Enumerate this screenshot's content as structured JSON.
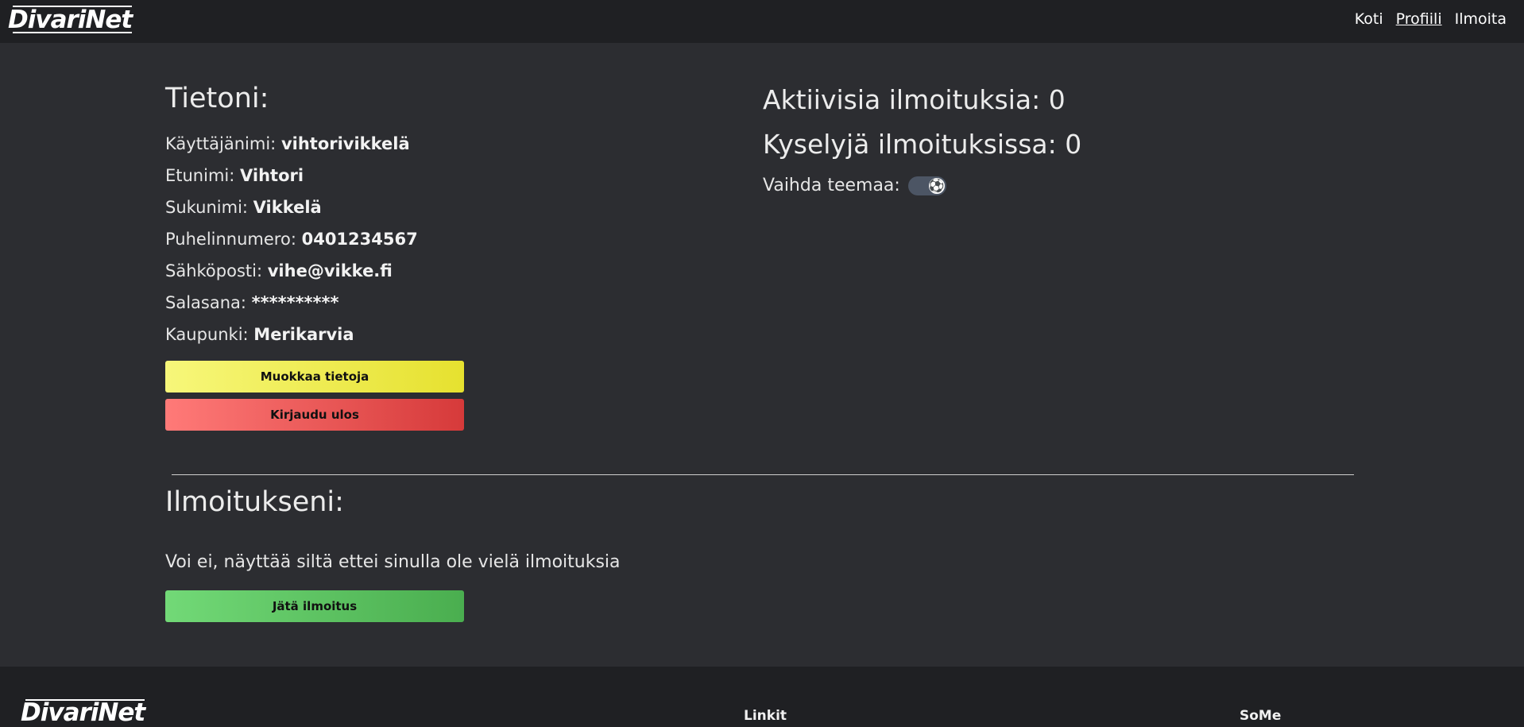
{
  "header": {
    "logo": "DivariNet",
    "nav": [
      {
        "label": "Koti",
        "active": false
      },
      {
        "label": "Profiili",
        "active": true
      },
      {
        "label": "Ilmoita",
        "active": false
      }
    ]
  },
  "profile": {
    "heading": "Tietoni:",
    "fields": [
      {
        "label": "Käyttäjänimi:",
        "value": "vihtorivikkelä"
      },
      {
        "label": "Etunimi:",
        "value": "Vihtori"
      },
      {
        "label": "Sukunimi:",
        "value": "Vikkelä"
      },
      {
        "label": "Puhelinnumero:",
        "value": "0401234567"
      },
      {
        "label": "Sähköposti:",
        "value": "vihe@vikke.fi"
      },
      {
        "label": "Salasana:",
        "value": "**********"
      },
      {
        "label": "Kaupunki:",
        "value": "Merikarvia"
      }
    ],
    "edit_button": "Muokkaa tietoja",
    "logout_button": "Kirjaudu ulos"
  },
  "stats": {
    "active_ads": "Aktiivisia ilmoituksia: 0",
    "queries": "Kyselyjä ilmoituksissa: 0",
    "theme_label": "Vaihda teemaa:",
    "theme_icon": "soccer-ball-icon",
    "theme_glyph": "⚽"
  },
  "my_ads": {
    "heading": "Ilmoitukseni:",
    "empty_message": "Voi ei, näyttää siltä ettei sinulla ole vielä ilmoituksia",
    "create_button": "Jätä ilmoitus"
  },
  "footer": {
    "logo": "DivariNet",
    "links_heading": "Linkit",
    "social_heading": "SoMe"
  },
  "colors": {
    "background": "#2c2d31",
    "header": "#1f2023",
    "edit": "#f0ee55",
    "logout": "#e85a58",
    "create": "#5ec463"
  }
}
